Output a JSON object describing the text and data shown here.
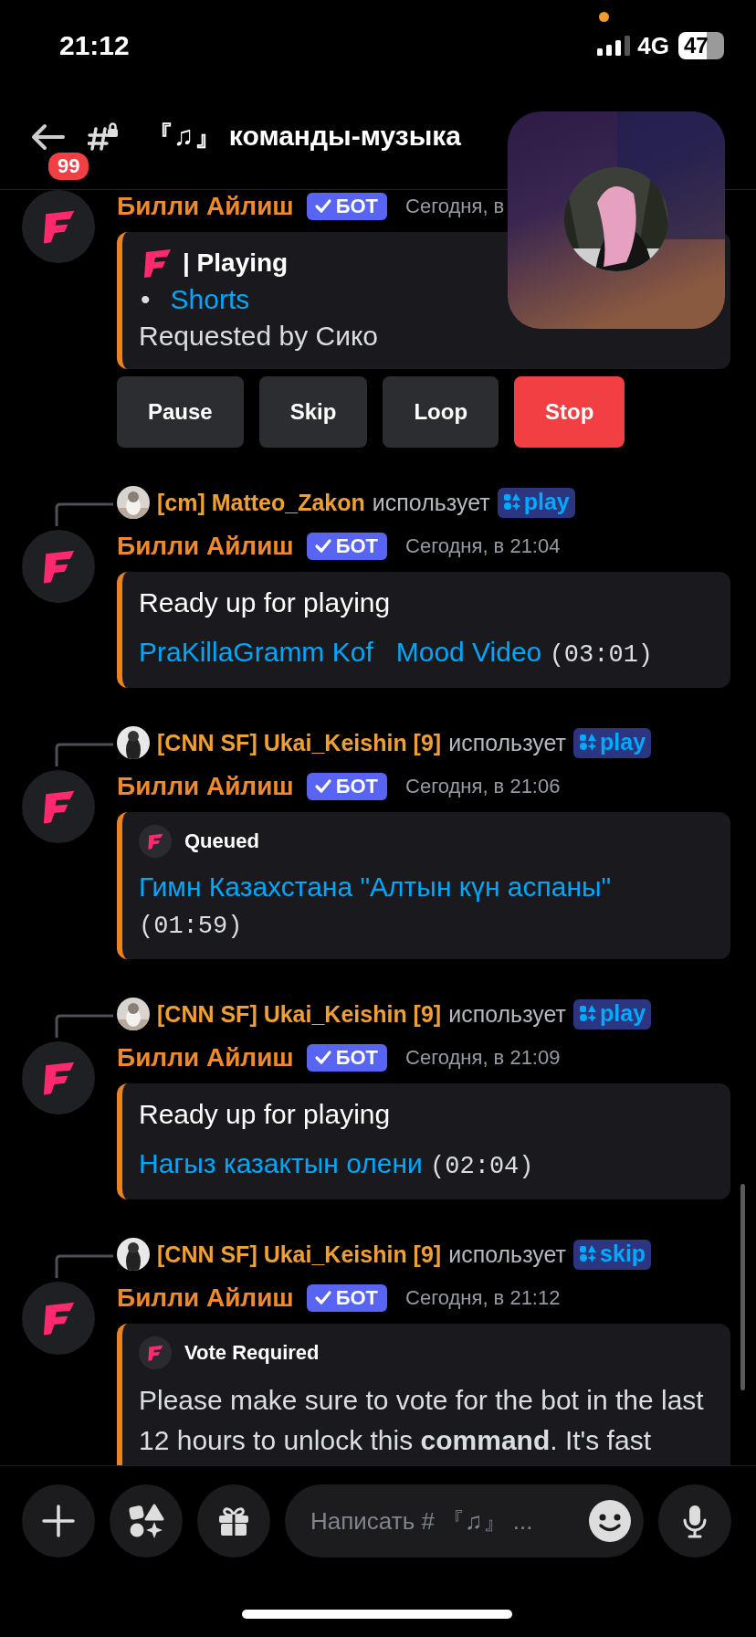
{
  "status_bar": {
    "time": "21:12",
    "network": "4G",
    "battery": "47"
  },
  "header": {
    "badge": "99",
    "title": "『♫』 команды-музыка"
  },
  "messages": [
    {
      "author": "Билли Айлиш",
      "tag": "БОТ",
      "time": "Сегодня, в",
      "embed": {
        "kind": "playing",
        "title": "| Playing",
        "items": [
          {
            "bullet": "•",
            "text": "Shorts"
          }
        ],
        "footer": "Requested by Сико"
      },
      "buttons": [
        {
          "label": "Pause",
          "kind": "secondary"
        },
        {
          "label": "Skip",
          "kind": "secondary"
        },
        {
          "label": "Loop",
          "kind": "secondary"
        },
        {
          "label": "Stop",
          "kind": "danger"
        }
      ]
    },
    {
      "reply": {
        "user": "[cm] Matteo_Zakon",
        "verb": "использует",
        "command": "play"
      },
      "author": "Билли Айлиш",
      "tag": "БОТ",
      "time": "Сегодня, в 21:04",
      "embed": {
        "kind": "tracks",
        "title": "Ready up for playing",
        "link": "PraKillaGramm Kof   Mood Video",
        "duration": "(03:01)"
      }
    },
    {
      "reply": {
        "user": "[CNN SF] Ukai_Keishin [9]",
        "verb": "использует",
        "command": "play"
      },
      "author": "Билли Айлиш",
      "tag": "БОТ",
      "time": "Сегодня, в 21:06",
      "embed": {
        "kind": "queued",
        "title": "Queued",
        "link": "Гимн Казахстана \"Алтын күн аспаны\"",
        "duration": "(01:59)"
      }
    },
    {
      "reply": {
        "user": "[CNN SF] Ukai_Keishin [9]",
        "verb": "использует",
        "command": "play"
      },
      "author": "Билли Айлиш",
      "tag": "БОТ",
      "time": "Сегодня, в 21:09",
      "embed": {
        "kind": "tracks",
        "title": "Ready up for playing",
        "link": "Нагыз казактын олени",
        "duration": "(02:04)"
      }
    },
    {
      "reply": {
        "user": "[CNN SF] Ukai_Keishin [9]",
        "verb": "использует",
        "command": "skip"
      },
      "author": "Билли Айлиш",
      "tag": "БОТ",
      "time": "Сегодня, в 21:12",
      "embed": {
        "kind": "notice",
        "title": "Vote Required",
        "text": "Please make sure to vote for the bot in the last 12 hours to unlock this **command**. It's fast"
      }
    }
  ],
  "composer": {
    "placeholder": "Написать # 『♫』 ..."
  }
}
